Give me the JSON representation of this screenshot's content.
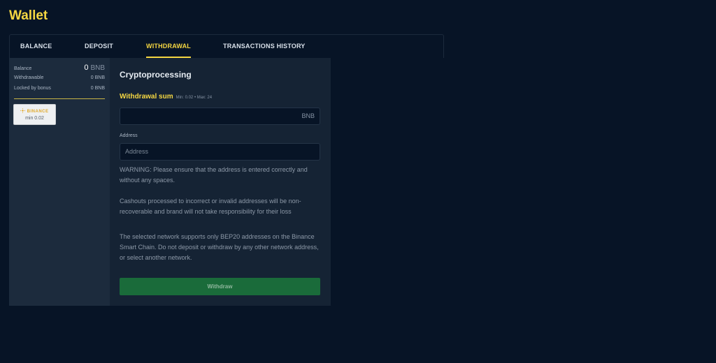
{
  "page": {
    "title": "Wallet"
  },
  "tabs": [
    {
      "label": "BALANCE",
      "active": false
    },
    {
      "label": "DEPOSIT",
      "active": false
    },
    {
      "label": "WITHDRAWAL",
      "active": true
    },
    {
      "label": "TRANSACTIONS HISTORY",
      "active": false
    }
  ],
  "balances": {
    "balance_label": "Balance",
    "balance_value": "0",
    "balance_unit": "BNB",
    "withdrawable_label": "Withdrawable",
    "withdrawable_value": "0 BNB",
    "locked_label": "Locked by bonus",
    "locked_value": "0 BNB"
  },
  "method": {
    "name": "BINANCE",
    "icon": "binance-icon",
    "min_label": "min 0.02"
  },
  "form": {
    "title": "Cryptoprocessing",
    "sum_label": "Withdrawal sum",
    "sum_hint": "Min: 0.02 • Max: 24",
    "sum_value": "",
    "sum_currency": "BNB",
    "address_label": "Address",
    "address_placeholder": "Address",
    "warning": "WARNING: Please ensure that the address is entered correctly and without any spaces.",
    "cashout_note": "Cashouts processed to incorrect or invalid addresses will be non-recoverable and brand will not take responsibility for their loss",
    "network_note": "The selected network supports only BEP20 addresses on the Binance Smart Chain. Do not deposit or withdraw by any other network address, or select another network.",
    "submit_label": "Withdraw"
  },
  "colors": {
    "accent": "#f5d742",
    "background": "#071426",
    "panel": "#152334",
    "sidebar": "#1c2b3d",
    "button": "#1a6b3a"
  }
}
